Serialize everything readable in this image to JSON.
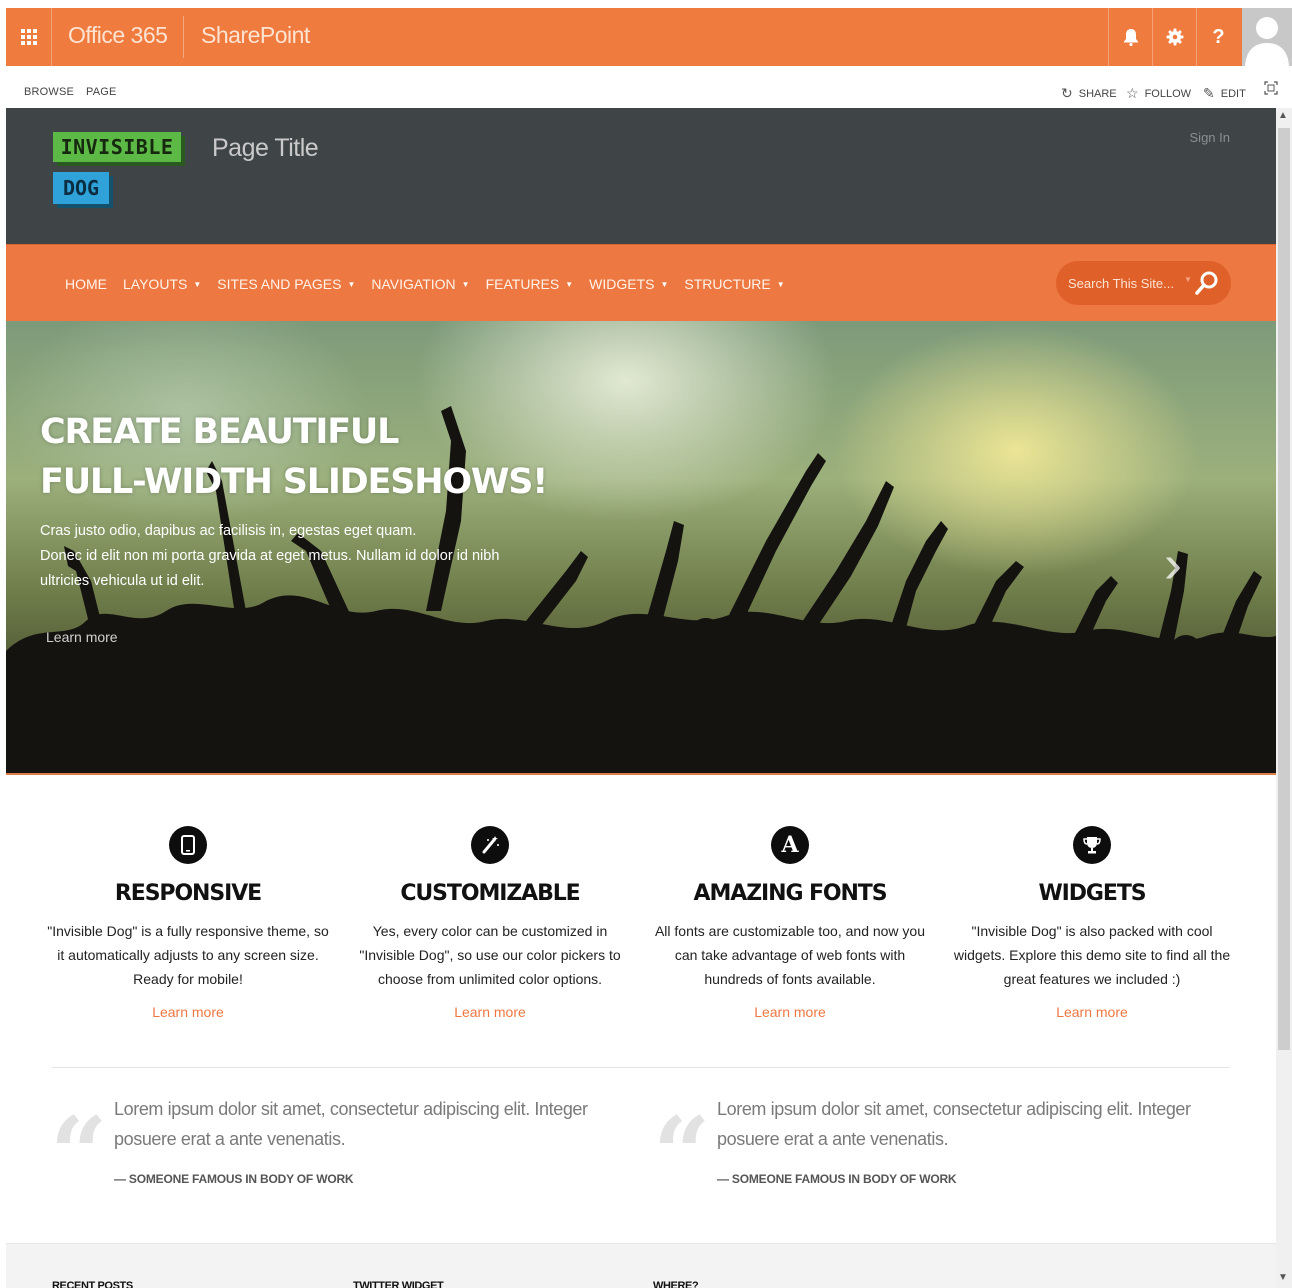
{
  "suite_bar": {
    "brand": "Office 365",
    "app": "SharePoint",
    "icons": [
      "waffle-icon",
      "bell-icon",
      "gear-icon",
      "help-icon",
      "user-avatar"
    ],
    "help_label": "?"
  },
  "ribbon": {
    "tabs": [
      "BROWSE",
      "PAGE"
    ],
    "actions": {
      "share": "SHARE",
      "follow": "FOLLOW",
      "edit": "EDIT"
    }
  },
  "header": {
    "logo_top": "INVISIBLE",
    "logo_bottom": "DOG",
    "page_title": "Page Title",
    "sign_in": "Sign In"
  },
  "nav": {
    "items": [
      {
        "label": "HOME"
      },
      {
        "label": "LAYOUTS"
      },
      {
        "label": "SITES AND PAGES"
      },
      {
        "label": "NAVIGATION"
      },
      {
        "label": "FEATURES"
      },
      {
        "label": "WIDGETS"
      },
      {
        "label": "STRUCTURE"
      }
    ],
    "search_placeholder": "Search This Site..."
  },
  "hero": {
    "title_line1": "CREATE BEAUTIFUL",
    "title_line2": "FULL-WIDTH SLIDESHOWS!",
    "body_line1": "Cras justo odio, dapibus ac facilisis in, egestas eget quam.",
    "body_line2": "Donec id elit non mi porta gravida at eget metus. Nullam id dolor id nibh",
    "body_line3": "ultricies vehicula ut id elit.",
    "link": "Learn more",
    "next_arrow": "›"
  },
  "features": [
    {
      "title": "RESPONSIVE",
      "icon": "mobile-icon",
      "text": "\"Invisible Dog\" is a fully responsive theme, so it automatically adjusts to any screen size. Ready for mobile!",
      "link": "Learn more"
    },
    {
      "title": "CUSTOMIZABLE",
      "icon": "magic-wand-icon",
      "text": "Yes, every color can be customized in \"Invisible Dog\", so use our color pickers to choose from unlimited color options.",
      "link": "Learn more"
    },
    {
      "title": "AMAZING FONTS",
      "icon": "font-icon",
      "icon_glyph": "A",
      "text": "All fonts are customizable too, and now you can take advantage of web fonts with hundreds of fonts available.",
      "link": "Learn more"
    },
    {
      "title": "WIDGETS",
      "icon": "trophy-icon",
      "text": "\"Invisible Dog\" is also packed with cool widgets. Explore this demo site to find all the great features we included :)",
      "link": "Learn more"
    }
  ],
  "quotes": [
    {
      "text": "Lorem ipsum dolor sit amet, consectetur adipiscing elit. Integer posuere erat a ante venenatis.",
      "author": "— SOMEONE FAMOUS IN BODY OF WORK",
      "mark": "“"
    },
    {
      "text": "Lorem ipsum dolor sit amet, consectetur adipiscing elit. Integer posuere erat a ante venenatis.",
      "author": "— SOMEONE FAMOUS IN BODY OF WORK",
      "mark": "“"
    }
  ],
  "footer": {
    "headings": [
      "RECENT POSTS",
      "TWITTER WIDGET",
      "WHERE?"
    ]
  },
  "colors": {
    "accent_orange": "#f07b3f",
    "header_dark": "#3f4447",
    "logo_green": "#5cb945",
    "logo_blue": "#2fa3d9"
  }
}
